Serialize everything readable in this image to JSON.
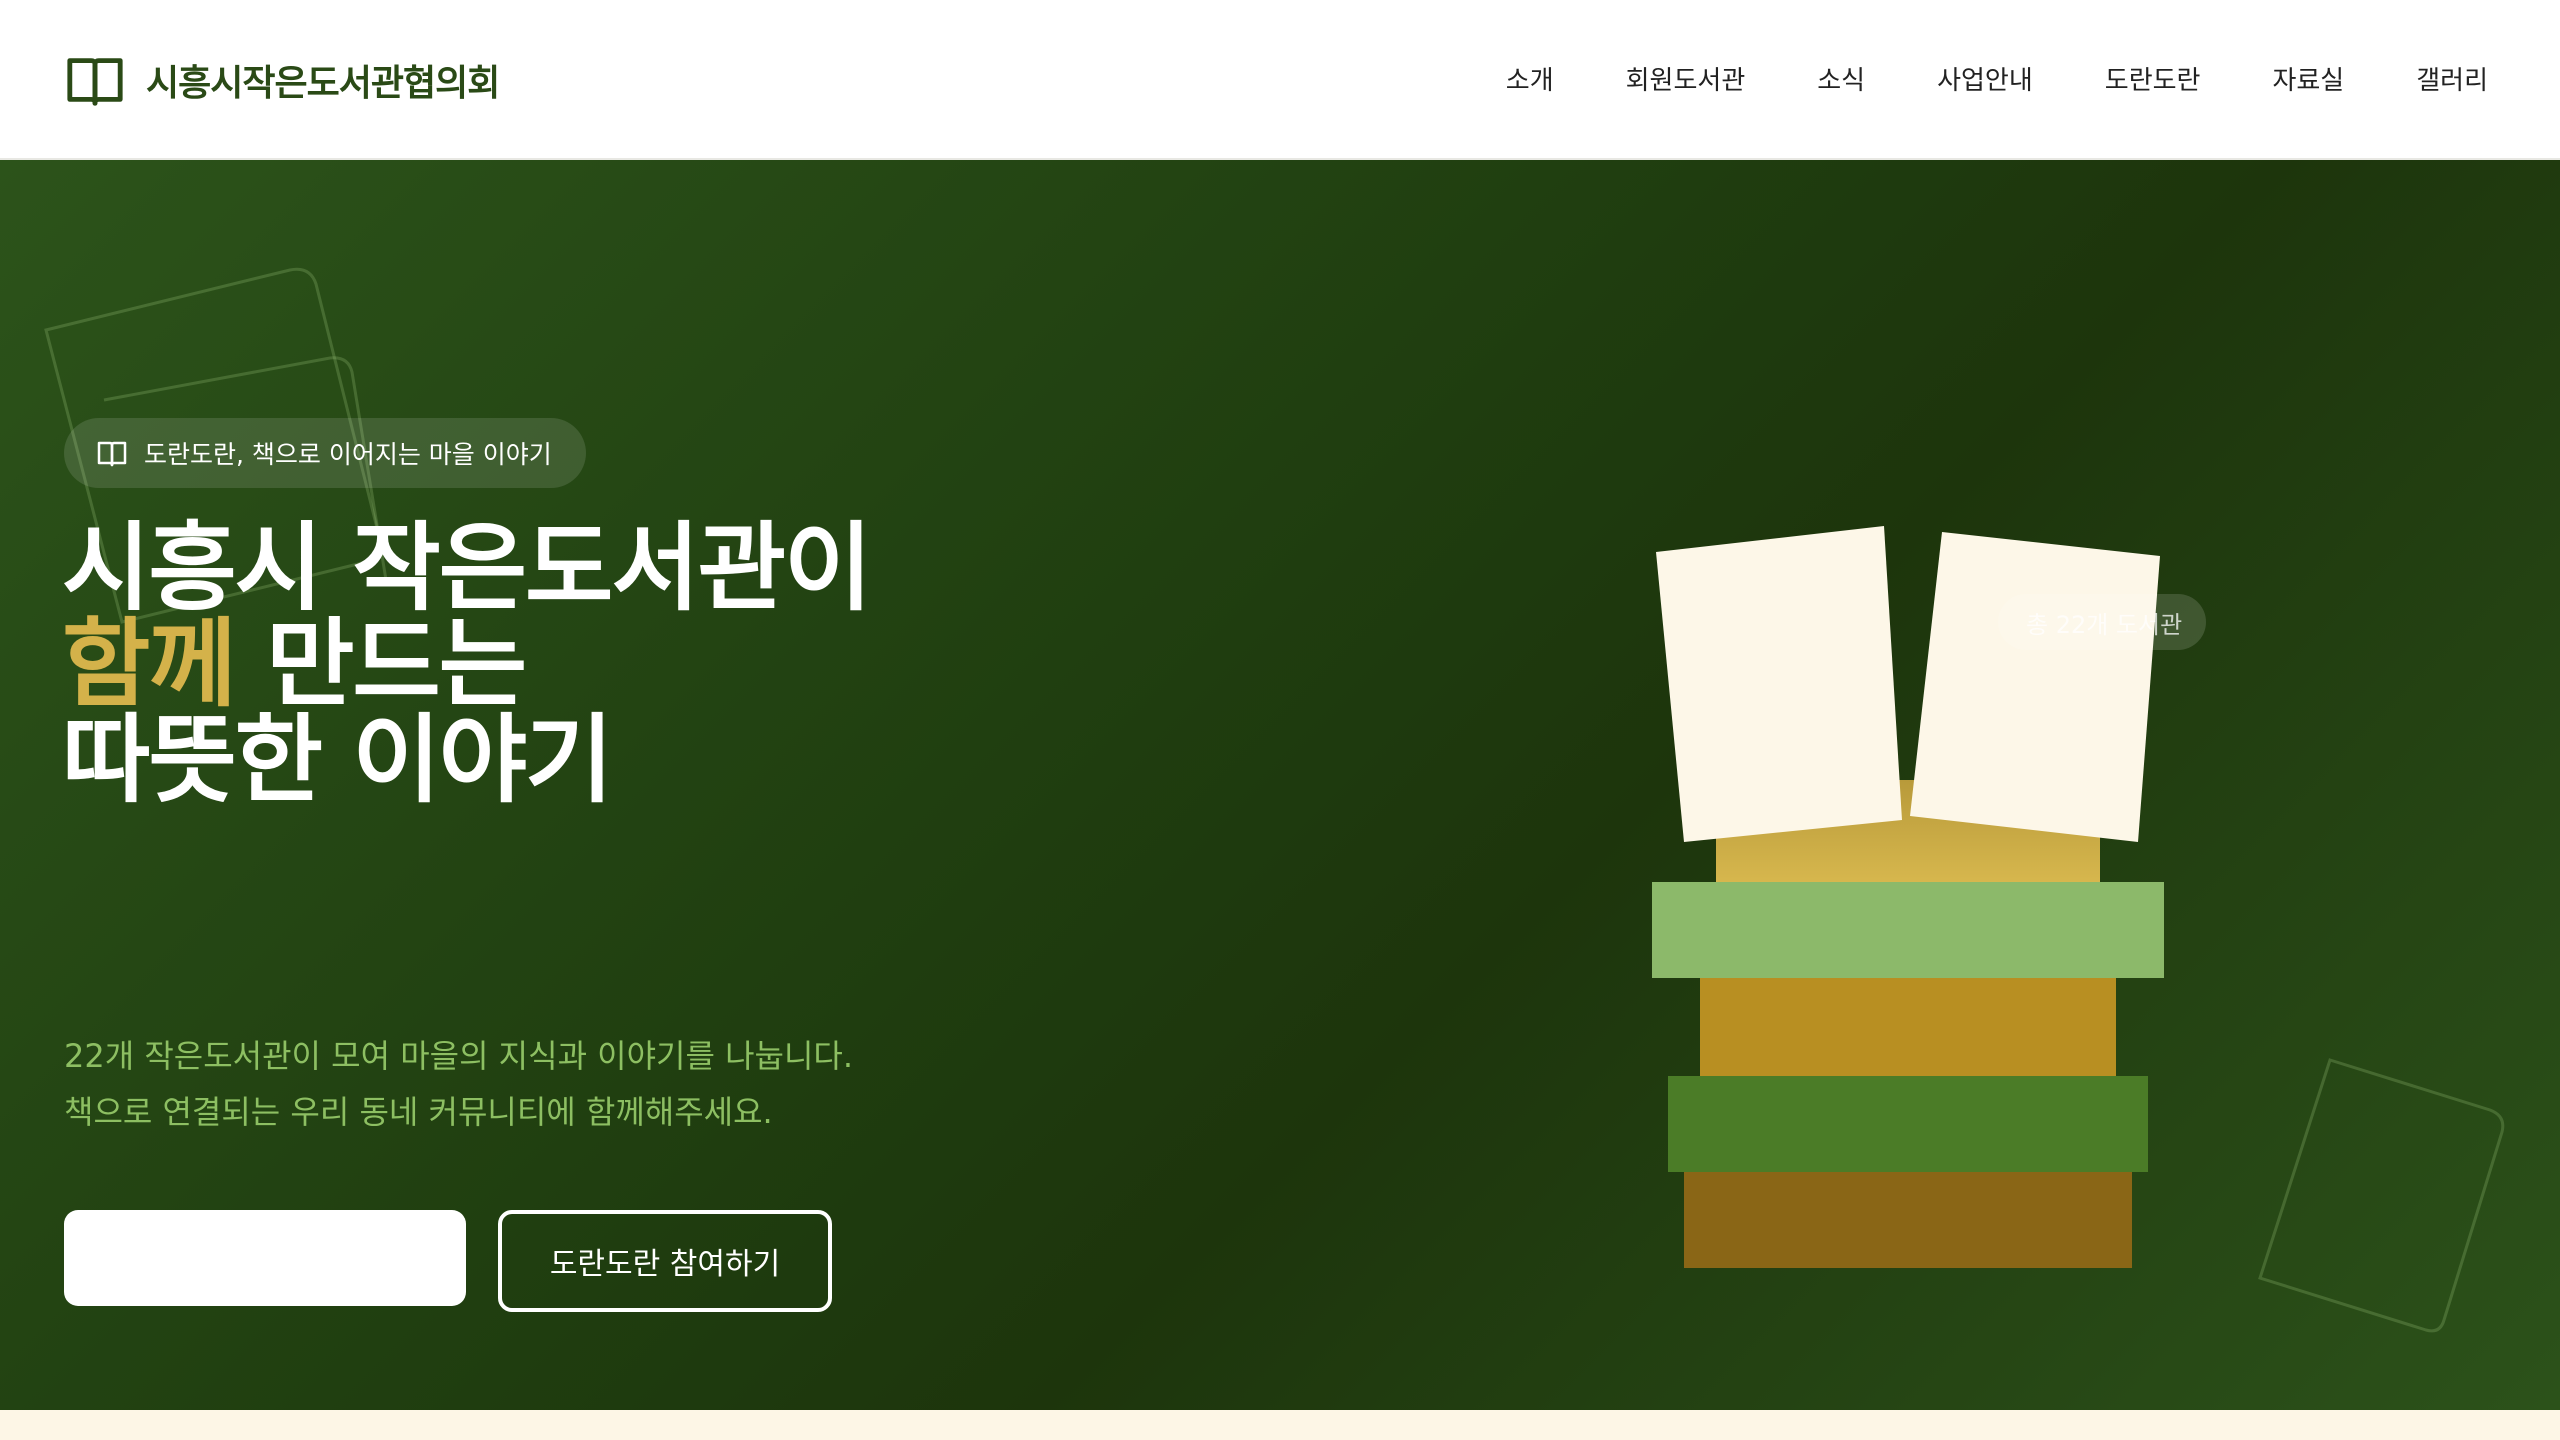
{
  "header": {
    "logo_text": "시흥시작은도서관협의회",
    "nav": [
      "소개",
      "회원도서관",
      "소식",
      "사업안내",
      "도란도란",
      "자료실",
      "갤러리"
    ]
  },
  "hero": {
    "badge": "도란도란, 책으로 이어지는 마을 이야기",
    "headline": {
      "line1": "시흥시 작은도서관이",
      "line2_accent": "함께",
      "line2_rest": " 만드는",
      "line3": "따뜻한 이야기"
    },
    "subtitle": [
      "22개 작은도서관이 모여 마을의 지식과 이야기를 나눕니다.",
      "책으로 연결되는 우리 동네 커뮤니티에 함께해주세요."
    ],
    "primary_button": "",
    "secondary_button": "도란도란 참여하기",
    "count_pill": "총 22개 도서관"
  },
  "colors": {
    "brand_green": "#2a4a16",
    "accent_gold": "#d4b24a",
    "subtitle_green": "#8dbf62",
    "hero_bg": "#1f3d0f",
    "page_bg": "#fdf6e6"
  },
  "icons": {
    "logo": "open-book-icon",
    "badge": "open-book-icon"
  }
}
